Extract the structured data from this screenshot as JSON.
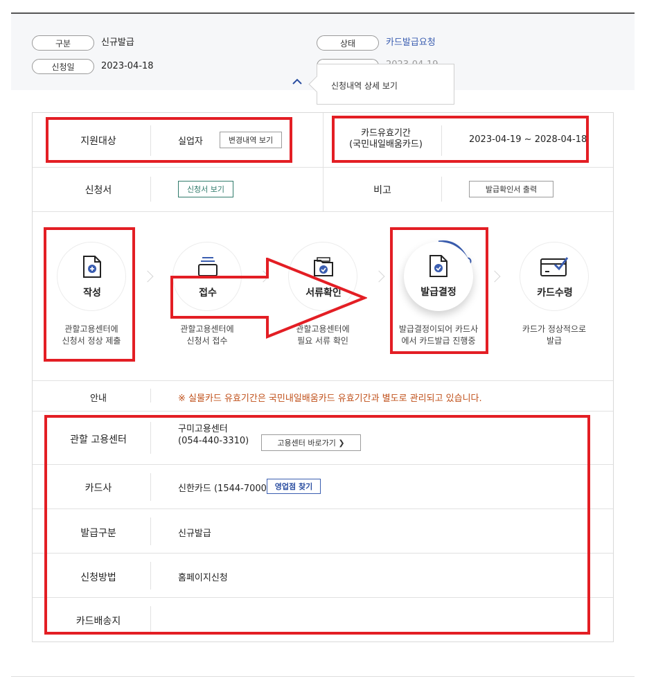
{
  "summary": {
    "type_label": "구분",
    "type_value": "신규발급",
    "date_label": "신청일",
    "date_value": "2023-04-18",
    "status_label": "상태",
    "status_value": "카드발급요청",
    "hidden_date_value": "2023-04-19"
  },
  "tooltip": {
    "text": "신청내역 상세 보기"
  },
  "detail": {
    "support_target_label": "지원대상",
    "support_target_value": "실업자",
    "change_history_button": "변경내역 보기",
    "card_validity_label_1": "카드유효기간",
    "card_validity_label_2": "(국민내일배움카드)",
    "card_validity_value": "2023-04-19 ~ 2028-04-18",
    "application_label": "신청서",
    "application_button": "신청서 보기",
    "remarks_label": "비고",
    "print_button": "발급확인서 출력"
  },
  "steps": [
    {
      "label": "작성",
      "desc1": "관할고용센터에",
      "desc2": "신청서 정상 제출",
      "icon": "document-plus-icon"
    },
    {
      "label": "접수",
      "desc1": "관할고용센터에",
      "desc2": "신청서 접수",
      "icon": "tray-icon"
    },
    {
      "label": "서류확인",
      "desc1": "관할고용센터에",
      "desc2": "필요 서류 확인",
      "icon": "folder-check-icon"
    },
    {
      "label": "발급결정",
      "desc1": "발급결정이되어 카드사",
      "desc2": "에서 카드발급 진행중",
      "icon": "document-check-icon"
    },
    {
      "label": "카드수령",
      "desc1": "카드가 정상적으로",
      "desc2": "발급",
      "icon": "card-check-icon"
    }
  ],
  "notice": {
    "label": "안내",
    "text": "※ 실물카드 유효기간은 국민내일배움카드 유효기간과 별도로 관리되고 있습니다."
  },
  "info": {
    "center_label": "관할 고용센터",
    "center_name": "구미고용센터",
    "center_phone": "(054-440-3310)",
    "center_button": "고용센터 바로가기 ❯",
    "card_company_label": "카드사",
    "card_company_value": "신한카드 (1544-7000)",
    "branch_button": "영업점 찾기",
    "issue_type_label": "발급구분",
    "issue_type_value": "신규발급",
    "method_label": "신청방법",
    "method_value": "홈페이지신청",
    "delivery_label": "카드배송지",
    "delivery_value": ""
  },
  "colors": {
    "accent_blue": "#3a5db0",
    "annotation_red": "#e31e24",
    "notice_orange": "#c0501a",
    "button_green": "#2f7a6a"
  },
  "progress": {
    "current_step_index": 3
  }
}
